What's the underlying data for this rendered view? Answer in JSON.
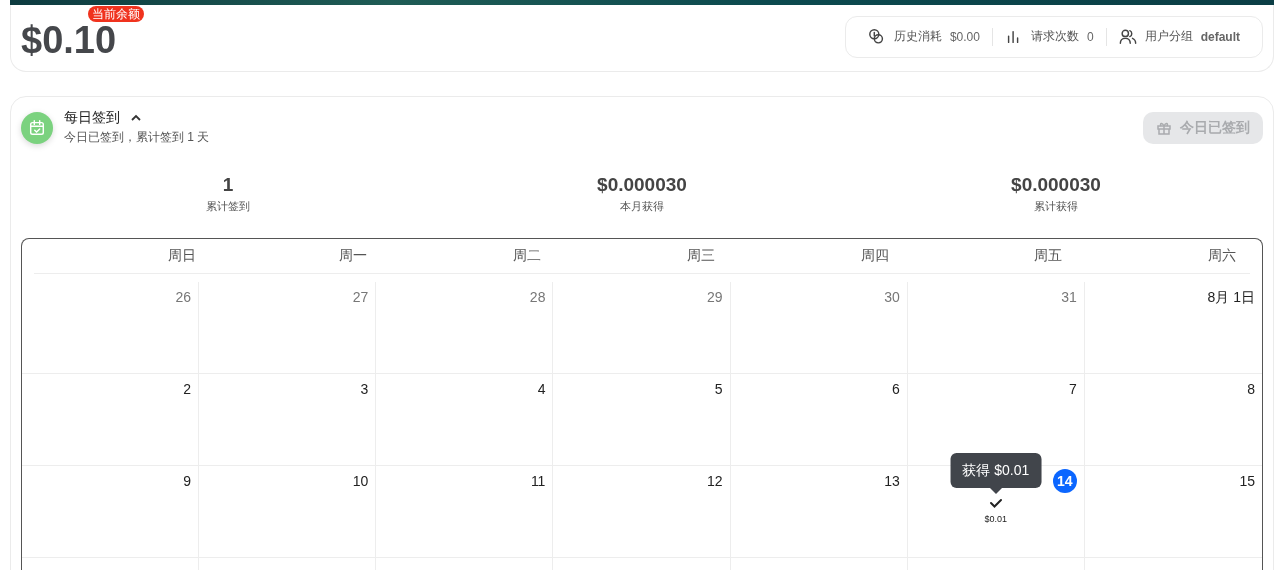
{
  "balance": {
    "amount": "$0.10",
    "badge": "当前余额"
  },
  "stats": [
    {
      "kind": "coins",
      "label": "历史消耗",
      "value": "$0.00"
    },
    {
      "kind": "chart",
      "label": "请求次数",
      "value": "0"
    },
    {
      "kind": "users",
      "label": "用户分组",
      "value": "default"
    }
  ],
  "checkin": {
    "title": "每日签到",
    "expanded": true,
    "subtitle": "今日已签到，累计签到 1 天",
    "button": {
      "label": "今日已签到",
      "disabled": true
    },
    "summary": [
      {
        "value": "1",
        "label": "累计签到"
      },
      {
        "value": "$0.000030",
        "label": "本月获得"
      },
      {
        "value": "$0.000030",
        "label": "累计获得"
      }
    ],
    "calendar": {
      "weekdays": [
        "周日",
        "周一",
        "周二",
        "周三",
        "周四",
        "周五",
        "周六"
      ],
      "weeks": [
        [
          {
            "label": "26",
            "outside": true
          },
          {
            "label": "27",
            "outside": true
          },
          {
            "label": "28",
            "outside": true
          },
          {
            "label": "29",
            "outside": true
          },
          {
            "label": "30",
            "outside": true
          },
          {
            "label": "31",
            "outside": true
          },
          {
            "label": "8月 1日",
            "outside": false
          }
        ],
        [
          {
            "label": "2",
            "outside": false
          },
          {
            "label": "3",
            "outside": false
          },
          {
            "label": "4",
            "outside": false
          },
          {
            "label": "5",
            "outside": false
          },
          {
            "label": "6",
            "outside": false
          },
          {
            "label": "7",
            "outside": false
          },
          {
            "label": "8",
            "outside": false
          }
        ],
        [
          {
            "label": "9",
            "outside": false
          },
          {
            "label": "10",
            "outside": false
          },
          {
            "label": "11",
            "outside": false
          },
          {
            "label": "12",
            "outside": false
          },
          {
            "label": "13",
            "outside": false
          },
          {
            "label": "14",
            "outside": false,
            "today": true,
            "checked_in": true,
            "reward": "$0.01",
            "tooltip": "获得 $0.01"
          },
          {
            "label": "15",
            "outside": false
          }
        ]
      ]
    }
  }
}
